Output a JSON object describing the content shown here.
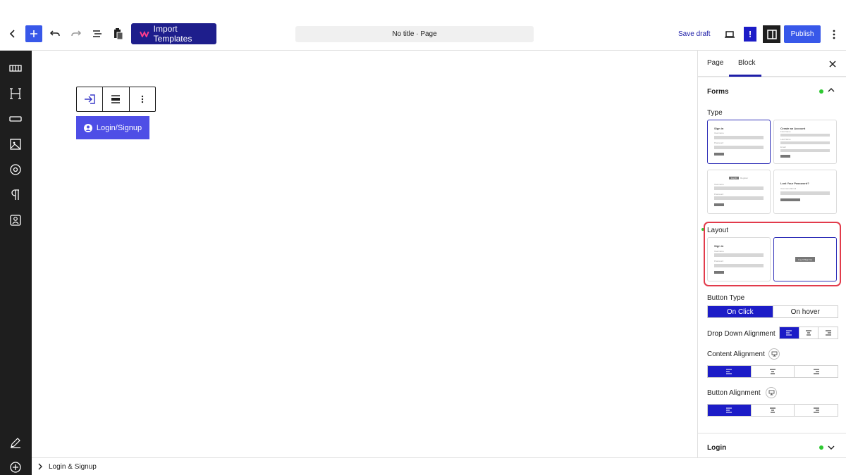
{
  "header": {
    "import_label": "Import Templates",
    "doc_title": "No title · Page",
    "save_draft": "Save draft",
    "publish": "Publish",
    "exclamation": "!"
  },
  "block": {
    "button_label": "Login/Signup"
  },
  "footer": {
    "breadcrumb": "Login & Signup"
  },
  "panel": {
    "tab_page": "Page",
    "tab_block": "Block",
    "forms_title": "Forms",
    "type_label": "Type",
    "type_cards": [
      {
        "title": "Sign in",
        "f1": "Username",
        "f2": "Password",
        "btn": "Log In"
      },
      {
        "title": "Create an Account",
        "f1": "First Name",
        "f2": "Last Name",
        "f3": "Email",
        "btn": "Sign Up"
      },
      {
        "tab1": "Log In",
        "tab2": "Register",
        "f1": "Username",
        "f2": "Password",
        "btn": "Log In"
      },
      {
        "title": "Lost Your Password?",
        "f1": "Username/Email",
        "btn": "Reset Password"
      }
    ],
    "layout_label": "Layout",
    "layout_cards": [
      {
        "title": "Sign in",
        "f1": "Username",
        "f2": "Password",
        "btn": "Log In"
      },
      {
        "btn": "Log In/Sign Up"
      }
    ],
    "button_type_label": "Button Type",
    "button_type_options": [
      "On Click",
      "On hover"
    ],
    "dropdown_alignment_label": "Drop Down Alignment",
    "content_alignment_label": "Content Alignment",
    "button_alignment_label": "Button Alignment",
    "login_section": "Login"
  },
  "colors": {
    "accent": "#1c1cc7",
    "primary_button": "#4e4ee6",
    "import_button": "#1e1e8c",
    "status_green": "#2ec932",
    "highlight": "#e23b4b"
  }
}
